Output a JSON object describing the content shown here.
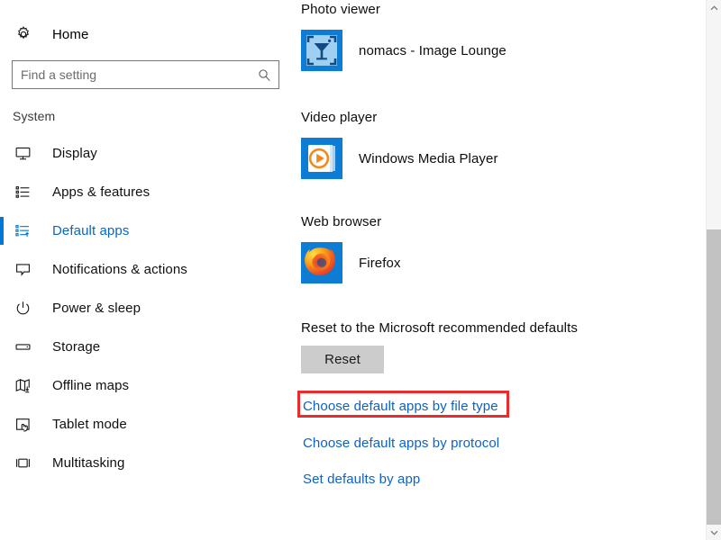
{
  "sidebar": {
    "home": {
      "label": "Home",
      "icon": "gear-icon"
    },
    "search": {
      "placeholder": "Find a setting",
      "value": "",
      "icon": "search-icon"
    },
    "section_label": "System",
    "items": [
      {
        "label": "Display",
        "icon": "monitor-icon",
        "selected": false
      },
      {
        "label": "Apps & features",
        "icon": "list-icon",
        "selected": false
      },
      {
        "label": "Default apps",
        "icon": "list-arrow-icon",
        "selected": true
      },
      {
        "label": "Notifications & actions",
        "icon": "speech-bubble-icon",
        "selected": false
      },
      {
        "label": "Power & sleep",
        "icon": "power-icon",
        "selected": false
      },
      {
        "label": "Storage",
        "icon": "drive-icon",
        "selected": false
      },
      {
        "label": "Offline maps",
        "icon": "map-download-icon",
        "selected": false
      },
      {
        "label": "Tablet mode",
        "icon": "tablet-hand-icon",
        "selected": false
      },
      {
        "label": "Multitasking",
        "icon": "multitask-icon",
        "selected": false
      }
    ]
  },
  "main": {
    "categories": [
      {
        "title": "Photo viewer",
        "app": {
          "name": "nomacs - Image Lounge",
          "icon": "nomacs-icon"
        }
      },
      {
        "title": "Video player",
        "app": {
          "name": "Windows Media Player",
          "icon": "windows-media-player-icon"
        }
      },
      {
        "title": "Web browser",
        "app": {
          "name": "Firefox",
          "icon": "firefox-icon"
        }
      }
    ],
    "reset": {
      "title": "Reset to the Microsoft recommended defaults",
      "button_label": "Reset"
    },
    "links": [
      {
        "label": "Choose default apps by file type",
        "highlighted": true
      },
      {
        "label": "Choose default apps by protocol",
        "highlighted": false
      },
      {
        "label": "Set defaults by app",
        "highlighted": false
      }
    ]
  },
  "scrollbar": {
    "up_arrow": "chevron-up-icon",
    "down_arrow": "chevron-down-icon"
  },
  "colors": {
    "accent": "#0078d7",
    "link": "#0c62c8",
    "highlight": "#ec2c2c",
    "button_bg": "#cccccc"
  }
}
